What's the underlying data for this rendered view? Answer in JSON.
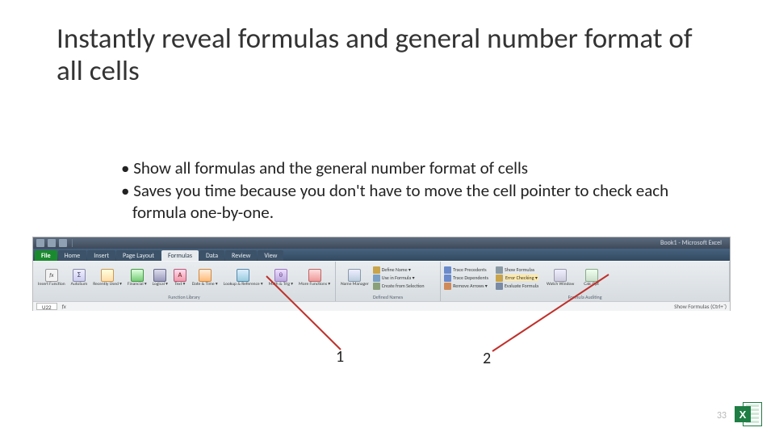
{
  "title": "Instantly reveal formulas and general number format of all cells",
  "bullets": [
    "Show all formulas and the general number format of cells",
    "Saves you time because you don't have to move the cell pointer to check each formula one-by-one."
  ],
  "ribbon": {
    "windowTitle": "Book1 - Microsoft Excel",
    "tabs": {
      "file": "File",
      "home": "Home",
      "insert": "Insert",
      "pageLayout": "Page Layout",
      "formulas": "Formulas",
      "data": "Data",
      "review": "Review",
      "view": "View"
    },
    "groups": {
      "functionLibrary": "Function Library",
      "definedNames": "Defined Names",
      "formulaAuditing": "Formula Auditing"
    },
    "buttons": {
      "insertFunction": "Insert\nFunction",
      "autoSum": "AutoSum",
      "recentlyUsed": "Recently\nUsed ▾",
      "financial": "Financial\n▾",
      "logical": "Logical\n▾",
      "text": "Text\n▾",
      "dateTime": "Date &\nTime ▾",
      "lookupRef": "Lookup &\nReference ▾",
      "mathTrig": "Math &\nTrig ▾",
      "moreFns": "More\nFunctions ▾",
      "nameManager": "Name\nManager",
      "watchWindow": "Watch\nWindow",
      "calcOptions": "Calc\nOpt"
    },
    "smallItems": {
      "defineName": "Define Name ▾",
      "useInFormula": "Use in Formula ▾",
      "createFromSelection": "Create from Selection",
      "tracePrecedents": "Trace Precedents",
      "traceDependents": "Trace Dependents",
      "removeArrows": "Remove Arrows ▾",
      "showFormulas": "Show Formulas",
      "errorChecking": "Error Checking ▾",
      "evaluateFormula": "Evaluate Formula"
    },
    "nameBox": "U22",
    "tooltip": "Show Formulas (Ctrl+`)",
    "sigma": "Σ",
    "fx": "fx",
    "A": "A",
    "theta": "θ"
  },
  "callouts": {
    "one": "1",
    "two": "2"
  },
  "slideNumber": "33",
  "excelBadge": "X"
}
